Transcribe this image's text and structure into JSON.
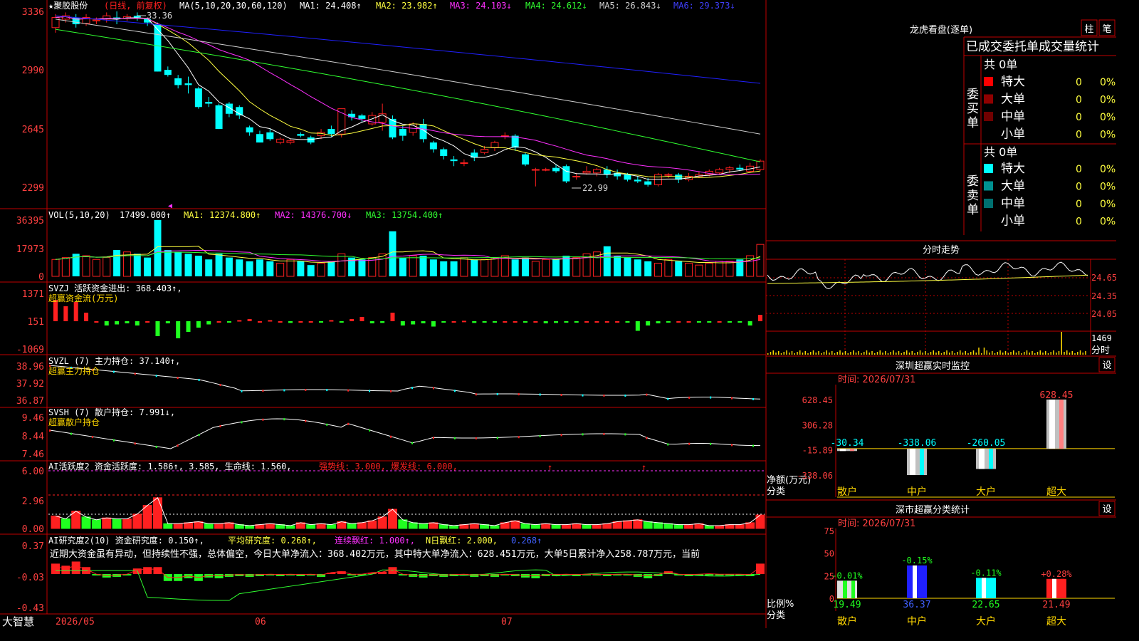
{
  "colors": {
    "up": "#ff2020",
    "down": "#00ffff",
    "grid": "#c00000",
    "axis_text": "#ff4040",
    "ma1": "#ffffff",
    "ma2": "#ffff40",
    "ma3": "#ff30ff",
    "ma4": "#30ff30",
    "ma5": "#d0d0d0",
    "ma6": "#2020ff"
  },
  "main": {
    "stock_name": "★聚胶股份",
    "period": "(日线, 前复权)",
    "ma_label": "MA(5,10,20,30,60,120)",
    "ma1": "MA1: 24.408↑",
    "ma2": "MA2: 23.982↑",
    "ma3": "MA3: 24.103↓",
    "ma4": "MA4: 24.612↓",
    "ma5": "MA5: 26.843↓",
    "ma6": "MA6: 29.373↓",
    "y_ticks": [
      "3336",
      "2990",
      "2645",
      "2299"
    ],
    "high_label": "33.36",
    "low_label": "22.99",
    "y_range": [
      2200,
      3380
    ]
  },
  "vol": {
    "header": "VOL(5,10,20)",
    "value": "17499.000↑",
    "ma1": "MA1: 12374.800↑",
    "ma2": "MA2: 14376.700↓",
    "ma3": "MA3: 13754.400↑",
    "y_ticks": [
      "36395",
      "17973",
      "0"
    ]
  },
  "svzj": {
    "header": "SVZJ  活跃资金进出: 368.403↑,",
    "subtitle": "超赢资金流(万元)",
    "y_ticks": [
      "1371",
      "151",
      "-1069"
    ]
  },
  "svzl": {
    "header": "SVZL (7) 主力持仓: 37.140↑,",
    "subtitle": "超赢主力持仓",
    "y_ticks": [
      "38.96",
      "37.92",
      "36.87"
    ]
  },
  "svsh": {
    "header": "SVSH (7) 散户持仓: 7.991↓,",
    "subtitle": "超赢散户持仓",
    "y_ticks": [
      "9.46",
      "8.44",
      "7.46"
    ]
  },
  "ai_active": {
    "header_a": "AI活跃度2 资金活跃度: 1.586↑, 3.585, 生命线: 1.560,",
    "header_b": "强势线: 3.000, 爆发线: 6.000,",
    "y_ticks": [
      "6.00",
      "2.96",
      "0.00"
    ]
  },
  "ai_research": {
    "header_a": "AI研究度2(10) 资金研究度: 0.150↑,",
    "h_avg": "平均研究度: 0.268↑,",
    "h_cons": "连续飘红: 1.000↑,",
    "h_n": "N日飘红: 2.000,",
    "h_last": "0.268↑",
    "commentary": "近期大资金虽有异动，但持续性不强，总体偏空，今日大单净流入：368.402万元，其中特大单净流入：628.451万元，大单5日累计净入258.787万元，当前",
    "y_ticks": [
      "0.37",
      "-0.03",
      "-0.43"
    ]
  },
  "x_axis": {
    "brand": "大智慧",
    "labels": [
      "2026/05",
      "06",
      "07"
    ]
  },
  "dragon": {
    "title": "龙虎看盘(逐单)",
    "btn1": "柱",
    "btn2": "笔",
    "tabs": "已成交委托单成交量统计",
    "buy": {
      "side": "委买单",
      "count": "共 0单",
      "rows": [
        {
          "label": "特大",
          "n": "0",
          "p": "0%",
          "color": "#ff0000"
        },
        {
          "label": "大单",
          "n": "0",
          "p": "0%",
          "color": "#900000"
        },
        {
          "label": "中单",
          "n": "0",
          "p": "0%",
          "color": "#700000"
        },
        {
          "label": "小单",
          "n": "0",
          "p": "0%",
          "color": ""
        }
      ]
    },
    "sell": {
      "side": "委卖单",
      "count": "共 0单",
      "rows": [
        {
          "label": "特大",
          "n": "0",
          "p": "0%",
          "color": "#00ffff"
        },
        {
          "label": "大单",
          "n": "0",
          "p": "0%",
          "color": "#009090"
        },
        {
          "label": "中单",
          "n": "0",
          "p": "0%",
          "color": "#007070"
        },
        {
          "label": "小单",
          "n": "0",
          "p": "0%",
          "color": ""
        }
      ]
    }
  },
  "intraday": {
    "title": "分时走势",
    "y_ticks": [
      "24.65",
      "24.35",
      "24.05"
    ],
    "vol_tick": "1469",
    "unit": "分时"
  },
  "realtime": {
    "title": "深圳超赢实时监控",
    "btn": "设",
    "time": "时间: 2026/07/31",
    "y_ticks": [
      "628.45",
      "306.28",
      "-15.89",
      "-338.06"
    ],
    "ylabel": "净额(万元)",
    "xlabel": "分类"
  },
  "classify": {
    "title": "深市超赢分类统计",
    "btn": "设",
    "time": "时间: 2026/07/31",
    "y_ticks": [
      "75",
      "50",
      "25",
      "0"
    ],
    "ylabel": "比例%",
    "xlabel": "分类"
  },
  "chart_data": [
    {
      "type": "bar",
      "title": "深圳超赢实时监控",
      "categories": [
        "散户",
        "中户",
        "大户",
        "超大"
      ],
      "values": [
        -30.34,
        -338.06,
        -260.05,
        628.45
      ],
      "ylim": [
        -338.06,
        628.45
      ],
      "ylabel": "净额(万元)",
      "xlabel": "分类"
    },
    {
      "type": "bar",
      "title": "深市超赢分类统计",
      "categories": [
        "散户",
        "中户",
        "大户",
        "超大"
      ],
      "values": [
        19.49,
        36.37,
        22.65,
        21.49
      ],
      "changes": [
        "-0.01%",
        "-0.15%",
        "-0.11%",
        "+0.28%"
      ],
      "ylim": [
        0,
        75
      ],
      "ylabel": "比例%",
      "xlabel": "分类"
    }
  ]
}
